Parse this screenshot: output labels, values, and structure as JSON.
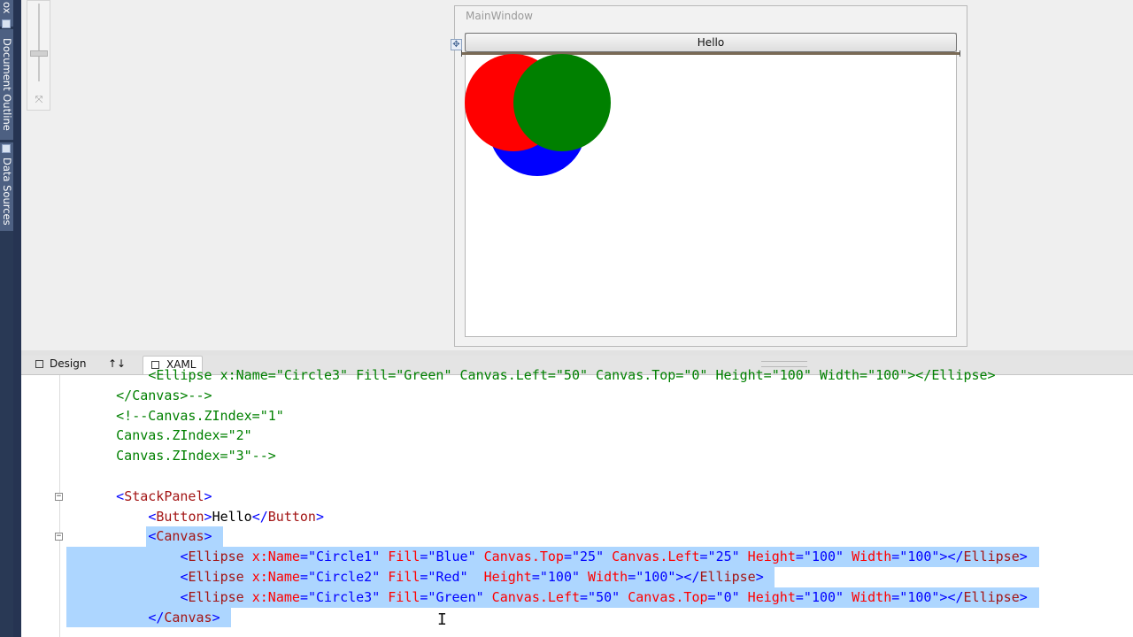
{
  "dock": {
    "tabs": [
      {
        "label": "ox"
      },
      {
        "label": "Document Outline"
      },
      {
        "label": "Data Sources"
      }
    ]
  },
  "designer": {
    "window_title": "MainWindow",
    "button_label": "Hello",
    "circles": [
      {
        "name": "Circle1",
        "color": "#0000ff"
      },
      {
        "name": "Circle2",
        "color": "#ff0000"
      },
      {
        "name": "Circle3",
        "color": "#008000"
      }
    ]
  },
  "view_tabs": {
    "design_label": "Design",
    "swap_label": "↑↓",
    "xaml_label": "XAML"
  },
  "editor": {
    "colors": {
      "comment": "#008000",
      "tag": "#a31515",
      "punct": "#0000ff",
      "attr": "#ff0000",
      "value": "#0000ff",
      "text": "#000000"
    },
    "lines": [
      {
        "indent": 4,
        "tokens": [
          {
            "t": "<Ellipse x:Name=\"Circle3\" Fill=\"Green\" Canvas.Left=\"50\" Canvas.Top=\"0\" Height=\"100\" Width=\"100\"></Ellipse>",
            "k": "comment"
          }
        ]
      },
      {
        "indent": 2,
        "tokens": [
          {
            "t": "</Canvas>-->",
            "k": "comment"
          }
        ]
      },
      {
        "indent": 2,
        "tokens": [
          {
            "t": "<!--Canvas.ZIndex=\"1\"",
            "k": "comment"
          }
        ]
      },
      {
        "indent": 2,
        "tokens": [
          {
            "t": "Canvas.ZIndex=\"2\"",
            "k": "comment"
          }
        ]
      },
      {
        "indent": 2,
        "tokens": [
          {
            "t": "Canvas.ZIndex=\"3\"-->",
            "k": "comment"
          }
        ]
      },
      {
        "indent": 0,
        "tokens": []
      },
      {
        "indent": 2,
        "outline": "−",
        "tokens": [
          {
            "t": "<",
            "k": "punct"
          },
          {
            "t": "StackPanel",
            "k": "tag"
          },
          {
            "t": ">",
            "k": "punct"
          }
        ]
      },
      {
        "indent": 4,
        "tokens": [
          {
            "t": "<",
            "k": "punct"
          },
          {
            "t": "Button",
            "k": "tag"
          },
          {
            "t": ">",
            "k": "punct"
          },
          {
            "t": "Hello",
            "k": "text"
          },
          {
            "t": "</",
            "k": "punct"
          },
          {
            "t": "Button",
            "k": "tag"
          },
          {
            "t": ">",
            "k": "punct"
          }
        ]
      },
      {
        "indent": 4,
        "outline": "−",
        "selected": true,
        "tokens": [
          {
            "t": "<",
            "k": "punct"
          },
          {
            "t": "Canvas",
            "k": "tag"
          },
          {
            "t": ">",
            "k": "punct"
          }
        ]
      },
      {
        "indent": 6,
        "selected": true,
        "tokens": [
          {
            "t": "<",
            "k": "punct"
          },
          {
            "t": "Ellipse",
            "k": "tag"
          },
          {
            "t": " x:Name",
            "k": "attr"
          },
          {
            "t": "=\"",
            "k": "punct"
          },
          {
            "t": "Circle1",
            "k": "value"
          },
          {
            "t": "\"",
            "k": "punct"
          },
          {
            "t": " Fill",
            "k": "attr"
          },
          {
            "t": "=\"",
            "k": "punct"
          },
          {
            "t": "Blue",
            "k": "value"
          },
          {
            "t": "\"",
            "k": "punct"
          },
          {
            "t": " Canvas.Top",
            "k": "attr"
          },
          {
            "t": "=\"",
            "k": "punct"
          },
          {
            "t": "25",
            "k": "value"
          },
          {
            "t": "\"",
            "k": "punct"
          },
          {
            "t": " Canvas.Left",
            "k": "attr"
          },
          {
            "t": "=\"",
            "k": "punct"
          },
          {
            "t": "25",
            "k": "value"
          },
          {
            "t": "\"",
            "k": "punct"
          },
          {
            "t": " Height",
            "k": "attr"
          },
          {
            "t": "=\"",
            "k": "punct"
          },
          {
            "t": "100",
            "k": "value"
          },
          {
            "t": "\"",
            "k": "punct"
          },
          {
            "t": " Width",
            "k": "attr"
          },
          {
            "t": "=\"",
            "k": "punct"
          },
          {
            "t": "100",
            "k": "value"
          },
          {
            "t": "\"></",
            "k": "punct"
          },
          {
            "t": "Ellipse",
            "k": "tag"
          },
          {
            "t": ">",
            "k": "punct"
          }
        ]
      },
      {
        "indent": 6,
        "selected": true,
        "tokens": [
          {
            "t": "<",
            "k": "punct"
          },
          {
            "t": "Ellipse",
            "k": "tag"
          },
          {
            "t": " x:Name",
            "k": "attr"
          },
          {
            "t": "=\"",
            "k": "punct"
          },
          {
            "t": "Circle2",
            "k": "value"
          },
          {
            "t": "\"",
            "k": "punct"
          },
          {
            "t": " Fill",
            "k": "attr"
          },
          {
            "t": "=\"",
            "k": "punct"
          },
          {
            "t": "Red",
            "k": "value"
          },
          {
            "t": "\"",
            "k": "punct"
          },
          {
            "t": "  Height",
            "k": "attr"
          },
          {
            "t": "=\"",
            "k": "punct"
          },
          {
            "t": "100",
            "k": "value"
          },
          {
            "t": "\"",
            "k": "punct"
          },
          {
            "t": " Width",
            "k": "attr"
          },
          {
            "t": "=\"",
            "k": "punct"
          },
          {
            "t": "100",
            "k": "value"
          },
          {
            "t": "\"></",
            "k": "punct"
          },
          {
            "t": "Ellipse",
            "k": "tag"
          },
          {
            "t": ">",
            "k": "punct"
          }
        ]
      },
      {
        "indent": 6,
        "selected": true,
        "tokens": [
          {
            "t": "<",
            "k": "punct"
          },
          {
            "t": "Ellipse",
            "k": "tag"
          },
          {
            "t": " x:Name",
            "k": "attr"
          },
          {
            "t": "=\"",
            "k": "punct"
          },
          {
            "t": "Circle3",
            "k": "value"
          },
          {
            "t": "\"",
            "k": "punct"
          },
          {
            "t": " Fill",
            "k": "attr"
          },
          {
            "t": "=\"",
            "k": "punct"
          },
          {
            "t": "Green",
            "k": "value"
          },
          {
            "t": "\"",
            "k": "punct"
          },
          {
            "t": " Canvas.Left",
            "k": "attr"
          },
          {
            "t": "=\"",
            "k": "punct"
          },
          {
            "t": "50",
            "k": "value"
          },
          {
            "t": "\"",
            "k": "punct"
          },
          {
            "t": " Canvas.Top",
            "k": "attr"
          },
          {
            "t": "=\"",
            "k": "punct"
          },
          {
            "t": "0",
            "k": "value"
          },
          {
            "t": "\"",
            "k": "punct"
          },
          {
            "t": " Height",
            "k": "attr"
          },
          {
            "t": "=\"",
            "k": "punct"
          },
          {
            "t": "100",
            "k": "value"
          },
          {
            "t": "\"",
            "k": "punct"
          },
          {
            "t": " Width",
            "k": "attr"
          },
          {
            "t": "=\"",
            "k": "punct"
          },
          {
            "t": "100",
            "k": "value"
          },
          {
            "t": "\"></",
            "k": "punct"
          },
          {
            "t": "Ellipse",
            "k": "tag"
          },
          {
            "t": ">",
            "k": "punct"
          }
        ]
      },
      {
        "indent": 4,
        "selected": true,
        "tokens": [
          {
            "t": "</",
            "k": "punct"
          },
          {
            "t": "Canvas",
            "k": "tag"
          },
          {
            "t": ">",
            "k": "punct"
          }
        ]
      }
    ]
  }
}
